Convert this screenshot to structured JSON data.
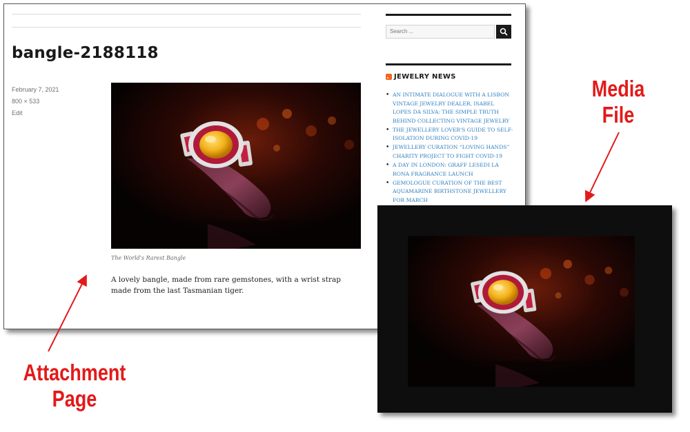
{
  "attachment_page": {
    "title": "bangle-2188118",
    "meta": {
      "date": "February 7, 2021",
      "dimensions": "800 × 533",
      "edit_label": "Edit"
    },
    "caption": "The World's Rarest Bangle",
    "description": "A lovely bangle, made from rare gemstones, with a wrist strap made from the last Tasmanian tiger."
  },
  "sidebar": {
    "search_placeholder": "Search ...",
    "widget_title": "JEWELRY NEWS",
    "news_items": [
      "AN INTIMATE DIALOGUE WITH A LISBON VINTAGE JEWELRY DEALER, ISABEL LOPES DA SILVA: THE SIMPLE TRUTH BEHIND COLLECTING VINTAGE JEWELRY",
      "THE JEWELLERY LOVER'S GUIDE TO SELF-ISOLATION DURING COVID-19",
      "JEWELLERY CURATION “LOVING HANDS” CHARITY PROJECT TO FIGHT COVID-19",
      "A DAY IN LONDON: GRAFF LESEDI LA RONA FRAGRANCE LAUNCH",
      "GEMOLOGUE CURATION OF THE BEST AQUAMARINE BIRTHSTONE JEWELLERY FOR MARCH"
    ]
  },
  "annotations": {
    "media_file_line1": "Media",
    "media_file_line2": "File",
    "attachment_page_line1": "Attachment",
    "attachment_page_line2": "Page"
  },
  "colors": {
    "annotation_red": "#e21a1a",
    "link_blue": "#2f7fbf",
    "rss_orange": "#f26522"
  }
}
